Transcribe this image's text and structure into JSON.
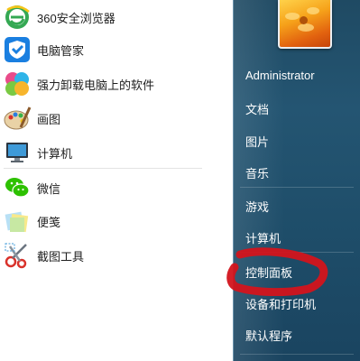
{
  "programs": [
    {
      "label": "360安全浏览器",
      "icon": "browser-360-icon"
    },
    {
      "label": "电脑管家",
      "icon": "pc-manager-shield-icon"
    },
    {
      "label": "强力卸载电脑上的软件",
      "icon": "uninstall-software-icon"
    },
    {
      "label": "画图",
      "icon": "paint-palette-icon"
    },
    {
      "label": "计算机",
      "icon": "computer-monitor-icon"
    },
    {
      "label": "微信",
      "icon": "wechat-icon"
    },
    {
      "label": "便笺",
      "icon": "sticky-notes-icon"
    },
    {
      "label": "截图工具",
      "icon": "snipping-tool-icon"
    }
  ],
  "right_menu": {
    "user": "Administrator",
    "items": [
      "文档",
      "图片",
      "音乐",
      "游戏",
      "计算机",
      "控制面板",
      "设备和打印机",
      "默认程序"
    ]
  },
  "colors": {
    "right_pane_bg": "#245572",
    "annotation_red": "#d3141c"
  }
}
